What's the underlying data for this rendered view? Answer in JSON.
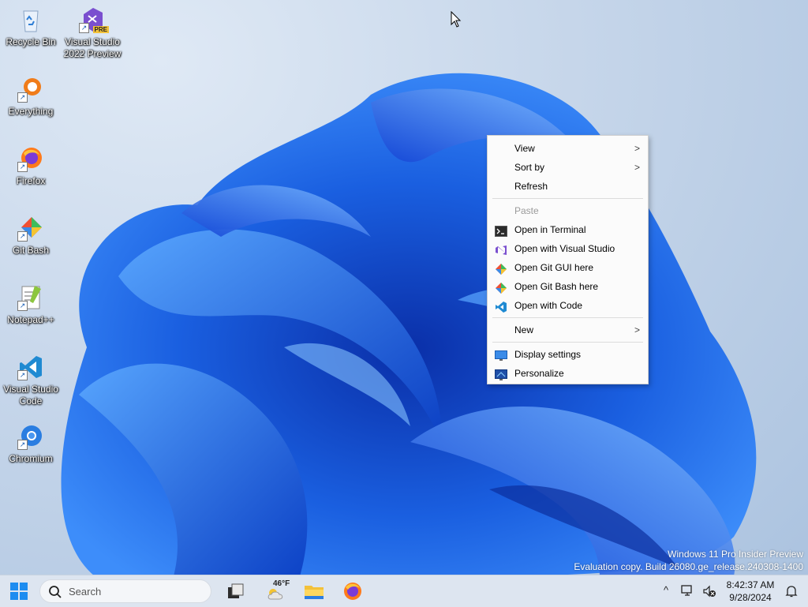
{
  "desktop": {
    "icons": [
      {
        "name": "Recycle Bin"
      },
      {
        "name": "Visual Studio 2022 Preview",
        "line1": "Visual Studio",
        "line2": "2022 Preview",
        "badge": "PRE"
      },
      {
        "name": "Everything"
      },
      {
        "name": "Firefox"
      },
      {
        "name": "Git Bash"
      },
      {
        "name": "Notepad++"
      },
      {
        "name": "Visual Studio Code",
        "line1": "Visual Studio",
        "line2": "Code"
      },
      {
        "name": "Chromium"
      }
    ],
    "shortcut_glyph": "↗"
  },
  "context_menu": {
    "items": [
      {
        "label": "View",
        "submenu": true
      },
      {
        "label": "Sort by",
        "submenu": true
      },
      {
        "label": "Refresh"
      },
      {
        "label": "Paste",
        "disabled": true
      },
      {
        "label": "Open in Terminal",
        "icon": "terminal-icon"
      },
      {
        "label": "Open with Visual Studio",
        "icon": "visual-studio-icon"
      },
      {
        "label": "Open Git GUI here",
        "icon": "git-gui-icon"
      },
      {
        "label": "Open Git Bash here",
        "icon": "git-bash-icon"
      },
      {
        "label": "Open with Code",
        "icon": "vscode-icon"
      },
      {
        "label": "New",
        "submenu": true
      },
      {
        "label": "Display settings",
        "icon": "display-icon"
      },
      {
        "label": "Personalize",
        "icon": "personalize-icon"
      }
    ],
    "submenu_arrow": ">"
  },
  "watermark": {
    "line1": "Windows 11 Pro Insider Preview",
    "line2": "Evaluation copy. Build 26080.ge_release.240308-1400"
  },
  "taskbar": {
    "search_placeholder": "Search",
    "weather_temp": "46°F",
    "clock_time": "8:42:37 AM",
    "clock_date": "9/28/2024",
    "tray_chevron": "^"
  },
  "colors": {
    "accent": "#0067c0",
    "wallpaper_blue": "#1a66e6",
    "taskbar_bg": "#dde5f0"
  }
}
